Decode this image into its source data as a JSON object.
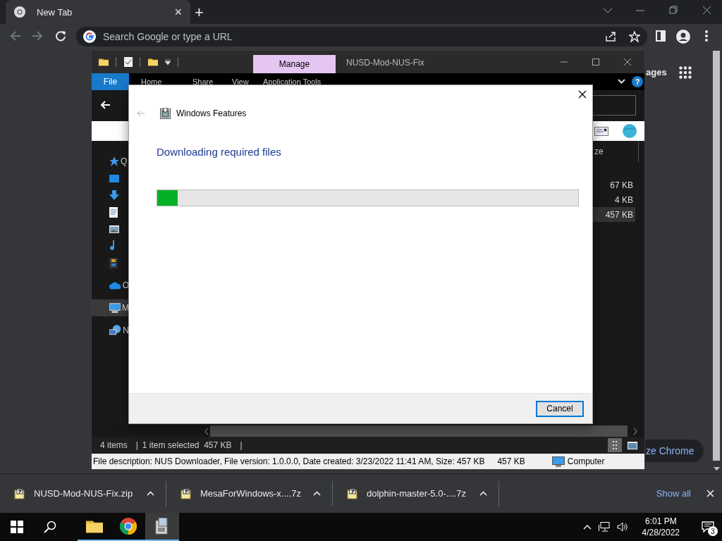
{
  "browser": {
    "tab": {
      "title": "New Tab",
      "close": "×"
    },
    "new_tab": "+",
    "omnibox": {
      "placeholder": "Search Google or type a URL"
    }
  },
  "new_tab_page": {
    "link": "ages",
    "customize_button": "ze Chrome"
  },
  "explorer": {
    "title": "NUSD-Mod-NUS-Fix",
    "context_tab": "Manage",
    "ribbon": {
      "file": "File",
      "tabs": [
        "Home",
        "Share",
        "View"
      ],
      "context": "Application Tools"
    },
    "help": "?",
    "nav_items": [
      {
        "kind": "star",
        "label": "Q",
        "selected": false
      },
      {
        "kind": "desktop",
        "selected": false
      },
      {
        "kind": "download",
        "selected": false
      },
      {
        "kind": "document",
        "selected": false
      },
      {
        "kind": "picture",
        "selected": false
      },
      {
        "kind": "music",
        "selected": false
      },
      {
        "kind": "video",
        "selected": false
      },
      {
        "kind": "cloud",
        "label": "O",
        "selected": false
      },
      {
        "kind": "pc",
        "label": "M",
        "selected": true
      },
      {
        "kind": "network",
        "label": "N",
        "selected": false
      }
    ],
    "column_header": "ze",
    "rows": [
      {
        "size": "67 KB",
        "selected": false
      },
      {
        "size": "4 KB",
        "selected": false
      },
      {
        "size": "457 KB",
        "selected": true
      }
    ],
    "status": {
      "items": "4 items",
      "separator": "|",
      "selection": "1 item selected  457 KB",
      "separator_2": "|"
    },
    "details": {
      "description": "File description: NUS Downloader, File version: 1.0.0.0, Date created: 3/23/2022 11:41 AM, Size: 457 KB",
      "size": "457 KB",
      "zone": "Computer"
    }
  },
  "dialog": {
    "title": "Windows Features",
    "heading": "Downloading required files",
    "progress": {
      "level": 0.048
    },
    "buttons": [
      "Cancel"
    ]
  },
  "downloads": {
    "items": [
      {
        "name": "NUSD-Mod-NUS-Fix.zip"
      },
      {
        "name": "MesaForWindows-x....7z"
      },
      {
        "name": "dolphin-master-5.0-....7z"
      }
    ],
    "show_all": "Show all"
  },
  "taskbar": {
    "apps": [
      {
        "kind": "explorer",
        "selected": false
      },
      {
        "kind": "chrome",
        "selected": false
      },
      {
        "kind": "features",
        "selected": true
      }
    ],
    "time": "6:01 PM",
    "date": "4/28/2022",
    "notifications": "3"
  }
}
